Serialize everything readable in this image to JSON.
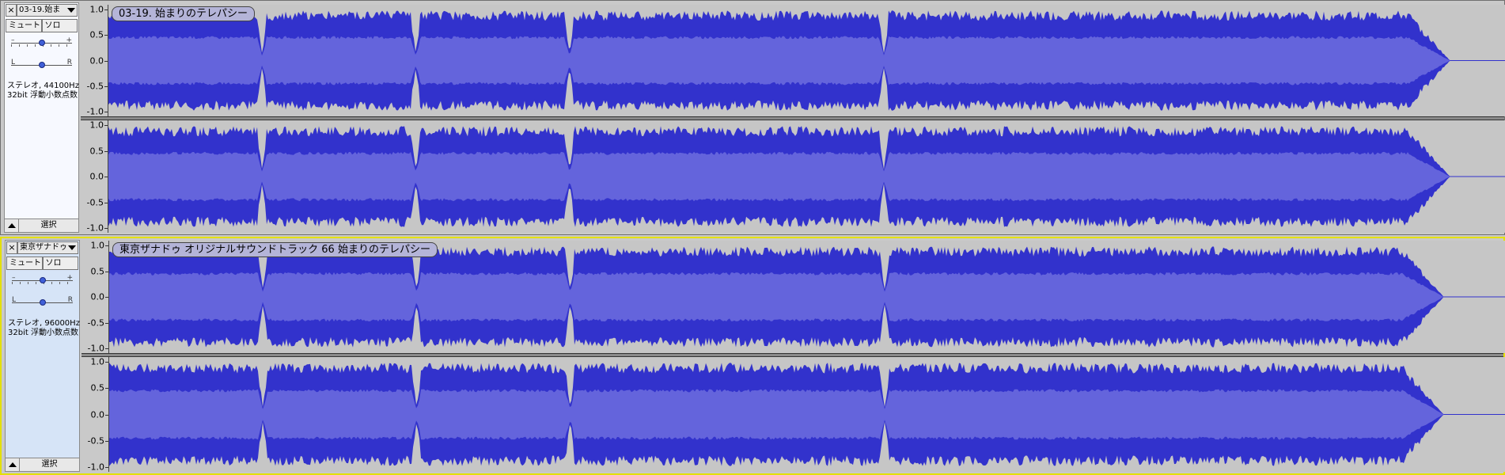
{
  "colors": {
    "wave_outer": "#3232cc",
    "wave_rms": "#6464dc",
    "background": "#c6c6c6",
    "selected_border": "#e4e000"
  },
  "tracks": [
    {
      "close_label": "×",
      "name": "03-19.始ま",
      "mute_label": "ミュート",
      "solo_label": "ソロ",
      "gain_minus": "–",
      "gain_plus": "+",
      "gain_level": 0.5,
      "pan_left": "L",
      "pan_right": "R",
      "pan_level": 0.5,
      "format_line1": "ステレオ, 44100Hz",
      "format_line2": "32bit 浮動小数点数",
      "select_label": "選択",
      "clip_name": "03-19. 始まりのテレパシー",
      "selected": false,
      "ruler_labels": [
        "1.0",
        "0.5",
        "0.0",
        "-0.5",
        "-1.0"
      ],
      "end_fraction": 0.96
    },
    {
      "close_label": "×",
      "name": "東京ザナドゥ",
      "mute_label": "ミュート",
      "solo_label": "ソロ",
      "gain_minus": "–",
      "gain_plus": "+",
      "gain_level": 0.5,
      "pan_left": "L",
      "pan_right": "R",
      "pan_level": 0.5,
      "format_line1": "ステレオ, 96000Hz",
      "format_line2": "32bit 浮動小数点数",
      "select_label": "選択",
      "clip_name": "東京ザナドゥ オリジナルサウンドトラック 66 始まりのテレパシー",
      "selected": true,
      "ruler_labels": [
        "1.0",
        "0.5",
        "0.0",
        "-0.5",
        "-1.0"
      ],
      "end_fraction": 0.955
    }
  ]
}
